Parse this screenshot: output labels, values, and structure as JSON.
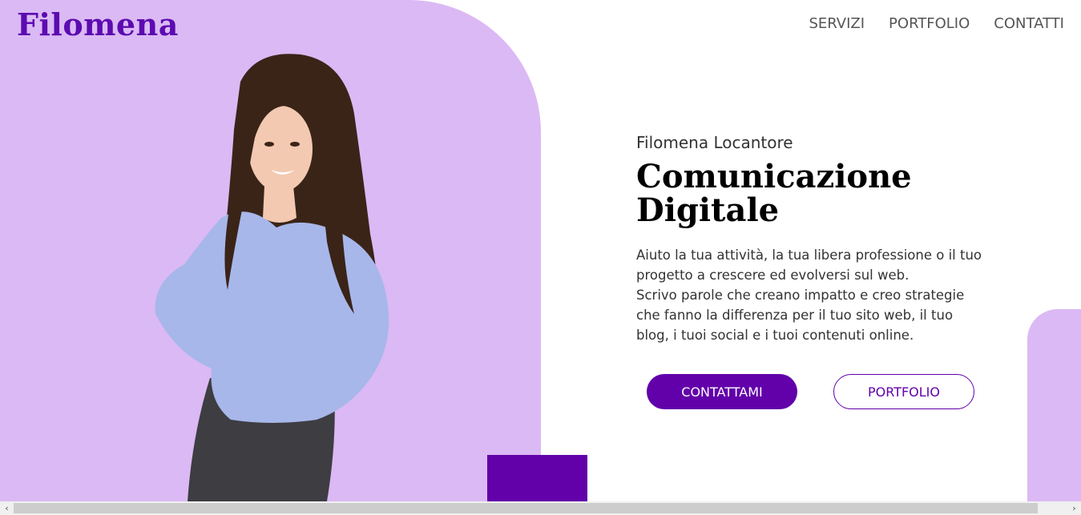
{
  "brand": {
    "logo_text": "Filomena"
  },
  "nav": {
    "items": [
      {
        "label": "SERVIZI"
      },
      {
        "label": "PORTFOLIO"
      },
      {
        "label": "CONTATTI"
      }
    ]
  },
  "hero": {
    "name": "Filomena Locantore",
    "headline": "Comunicazione Digitale",
    "description_lines": [
      "Aiuto la tua attività, la tua libera professione o il tuo",
      "progetto a crescere ed evolversi sul web.",
      "Scrivo parole che creano impatto e creo strategie",
      "che fanno la differenza per il tuo sito web, il tuo",
      "blog, i tuoi social e i tuoi contenuti online."
    ],
    "primary_button": "CONTATTAMI",
    "secondary_button": "PORTFOLIO"
  },
  "scrollbar": {
    "left_arrow": "‹",
    "right_arrow": "›"
  },
  "colors": {
    "lavender": "#dbb9f4",
    "purple": "#6200aa",
    "logo": "#5c0bb0",
    "sweater": "#a7b7ea",
    "hair": "#3a2418",
    "skin": "#f3c9b1",
    "jeans": "#3d3d42"
  }
}
